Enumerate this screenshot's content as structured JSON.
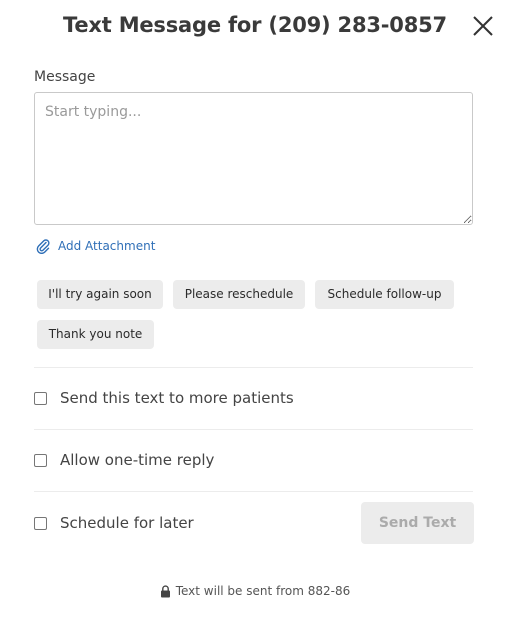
{
  "header": {
    "title": "Text Message for (209) 283-0857",
    "close_icon": "close-icon"
  },
  "message": {
    "label": "Message",
    "placeholder": "Start typing...",
    "value": ""
  },
  "attachment": {
    "icon": "paperclip-icon",
    "label": "Add Attachment"
  },
  "quick_replies": [
    {
      "label": "I'll try again soon"
    },
    {
      "label": "Please reschedule"
    },
    {
      "label": "Schedule follow-up"
    },
    {
      "label": "Thank you note"
    }
  ],
  "options": {
    "send_to_more": {
      "label": "Send this text to more patients",
      "checked": false
    },
    "one_time_reply": {
      "label": "Allow one-time reply",
      "checked": false
    },
    "schedule_later": {
      "label": "Schedule for later",
      "checked": false
    }
  },
  "send_button": {
    "label": "Send Text",
    "disabled": true
  },
  "footer": {
    "icon": "lock-icon",
    "text": "Text will be sent from 882-86"
  },
  "colors": {
    "link": "#2f6fb7",
    "chip_bg": "#ececec",
    "disabled_text": "#ababab"
  }
}
